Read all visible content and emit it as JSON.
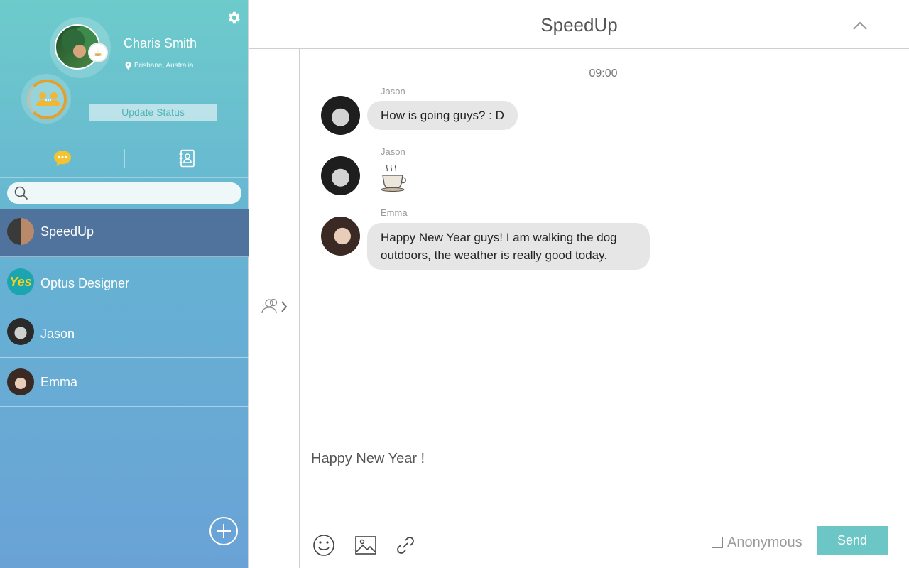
{
  "profile": {
    "name": "Charis Smith",
    "location": "Brisbane, Australia",
    "update_status_label": "Update Status"
  },
  "tabs": [
    {
      "id": "chats",
      "icon": "chat-bubble-icon",
      "active": true
    },
    {
      "id": "contacts",
      "icon": "address-book-icon",
      "active": false
    }
  ],
  "search": {
    "placeholder": "",
    "value": ""
  },
  "conversations": [
    {
      "name": "SpeedUp",
      "active": true
    },
    {
      "name": "Optus Designer",
      "active": false
    },
    {
      "name": "Jason",
      "active": false
    },
    {
      "name": "Emma",
      "active": false
    }
  ],
  "chat": {
    "title": "SpeedUp",
    "timestamp": "09:00",
    "messages": [
      {
        "sender": "Jason",
        "text": "How is going guys? : D"
      },
      {
        "sender": "Jason",
        "text": "",
        "sticker": "coffee-cup-icon"
      },
      {
        "sender": "Emma",
        "text": "Happy New Year guys! I am walking the dog outdoors, the weather is really good today."
      }
    ]
  },
  "composer": {
    "draft": "Happy New Year !",
    "anonymous_label": "Anonymous",
    "anonymous_checked": false,
    "send_label": "Send"
  },
  "colors": {
    "accent": "#6dc6c6",
    "active_conversation": "#50739d",
    "status_ring": "#e3a02a",
    "bubble": "#e6e6e6"
  }
}
